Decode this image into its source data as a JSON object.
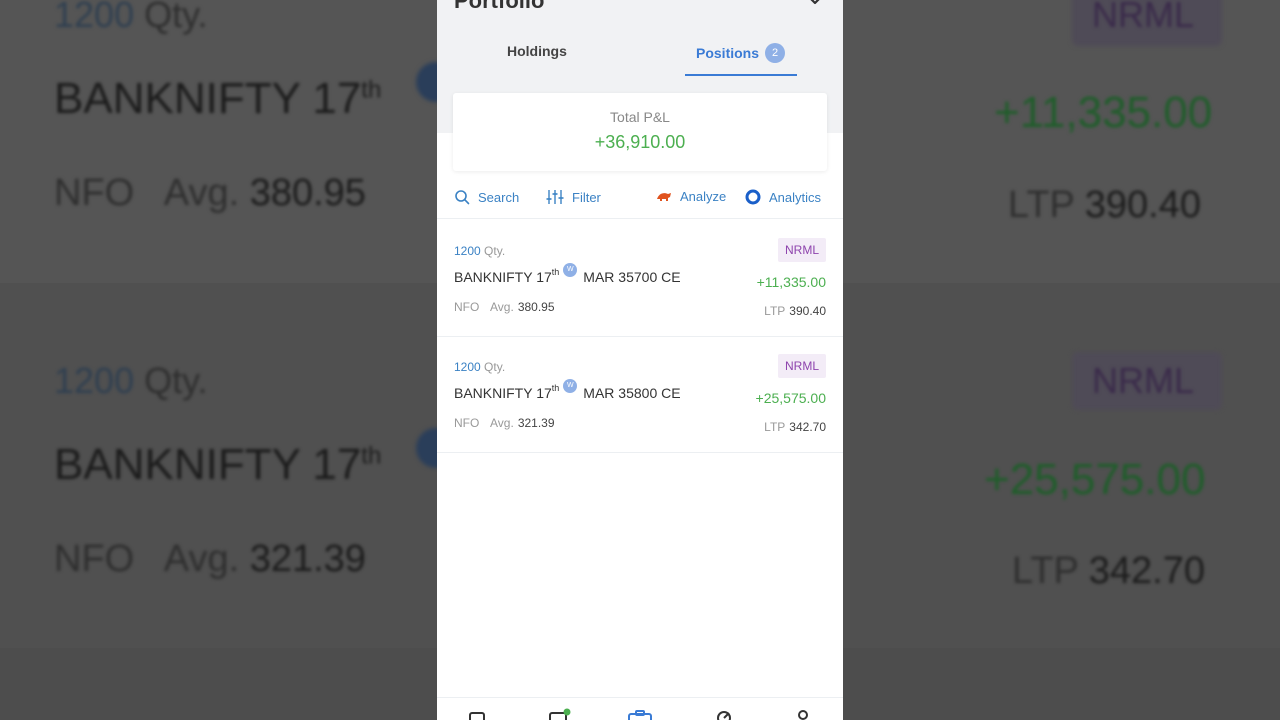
{
  "header": {
    "title": "Portfolio"
  },
  "tabs": {
    "holdings_label": "Holdings",
    "positions_label": "Positions",
    "positions_count": "2"
  },
  "summary": {
    "pnl_label": "Total P&L",
    "pnl_value": "+36,910.00"
  },
  "toolbar": {
    "search_label": "Search",
    "filter_label": "Filter",
    "analyze_label": "Analyze",
    "analytics_label": "Analytics"
  },
  "positions": [
    {
      "qty": "1200",
      "qty_unit": "Qty.",
      "symbol_prefix": "BANKNIFTY 17",
      "symbol_sup": "th",
      "weekly_badge": "W",
      "symbol_suffix": "MAR 35700 CE",
      "exchange": "NFO",
      "avg_label": "Avg.",
      "avg_value": "380.95",
      "product": "NRML",
      "pnl": "+11,335.00",
      "ltp_label": "LTP",
      "ltp_value": "390.40"
    },
    {
      "qty": "1200",
      "qty_unit": "Qty.",
      "symbol_prefix": "BANKNIFTY 17",
      "symbol_sup": "th",
      "weekly_badge": "W",
      "symbol_suffix": "MAR 35800 CE",
      "exchange": "NFO",
      "avg_label": "Avg.",
      "avg_value": "321.39",
      "product": "NRML",
      "pnl": "+25,575.00",
      "ltp_label": "LTP",
      "ltp_value": "342.70"
    }
  ],
  "colors": {
    "accent": "#3a7bd5",
    "profit": "#4caf50",
    "product_badge": "#8e44ad"
  },
  "bottom_nav_icons": [
    "watchlist-icon",
    "orders-icon",
    "portfolio-icon",
    "bids-icon",
    "account-icon"
  ]
}
